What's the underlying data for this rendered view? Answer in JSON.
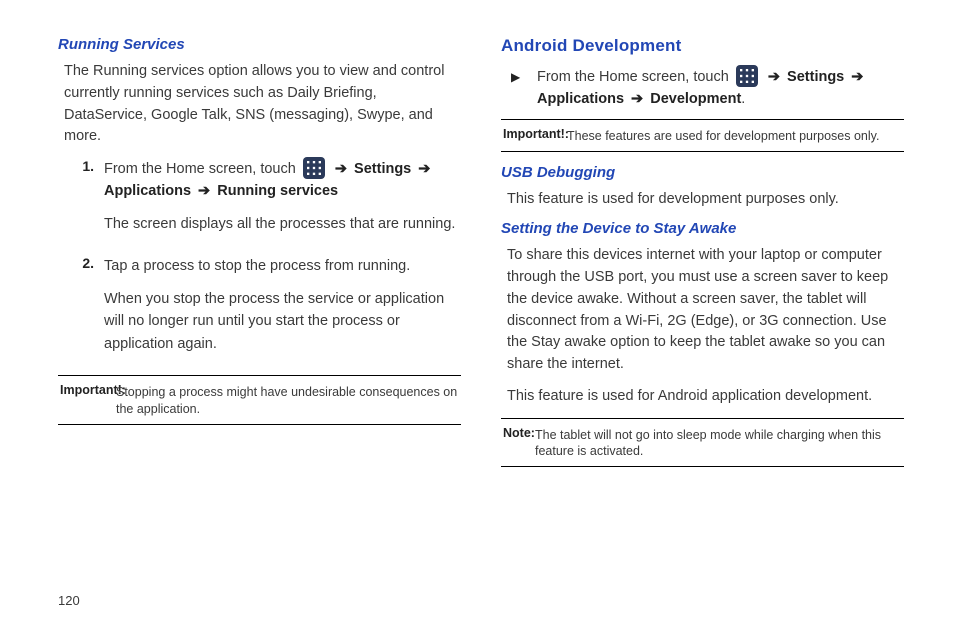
{
  "pageNumber": "120",
  "left": {
    "h1": "Running Services",
    "intro": "The Running services option allows you to view and control currently running services such as Daily Briefing, DataService, Google Talk, SNS (messaging), Swype, and more.",
    "step1_num": "1.",
    "step1_a": "From the Home screen, touch ",
    "step1_b_settings": "Settings",
    "step1_c_apps": "Applications",
    "step1_d_run": "Running services",
    "step1_desc": "The screen displays all the processes that are running.",
    "step2_num": "2.",
    "step2_a": "Tap a process to stop the process from running.",
    "step2_b": "When you stop the process the service or application will no longer run until you start the process or application again.",
    "important_label": "Important!:",
    "important_text": "Stopping a process might have undesirable consequences on the application."
  },
  "right": {
    "h1": "Android Development",
    "bullet_a": "From the Home screen, touch ",
    "bullet_settings": "Settings",
    "bullet_apps": "Applications",
    "bullet_dev": "Development",
    "important_label": "Important!:",
    "important_text": "These features are used for development purposes only.",
    "h2": "USB Debugging",
    "p2": "This feature is used for development purposes only.",
    "h3": "Setting the Device to Stay Awake",
    "p3a": "To share this devices internet with your laptop or computer through the USB port, you must use a screen saver to keep the device awake. Without a screen saver, the tablet will disconnect from a Wi-Fi, 2G (Edge), or 3G connection. Use the Stay awake option to keep the tablet awake so you can share the internet.",
    "p3b": "This feature is used for Android application development.",
    "note_label": "Note:",
    "note_text": "The tablet will not go into sleep mode while charging when this feature is activated."
  },
  "arrow": "➔"
}
